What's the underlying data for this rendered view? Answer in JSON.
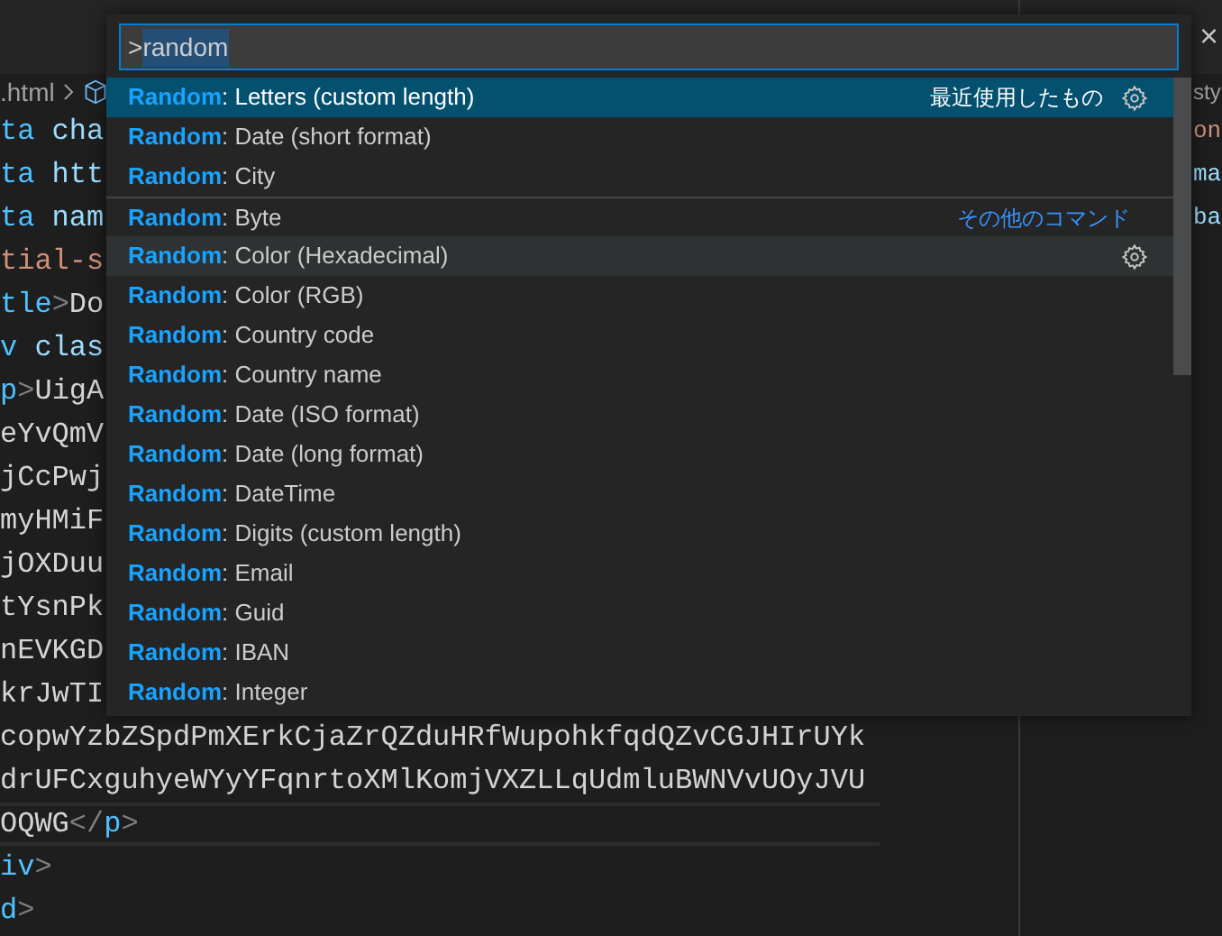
{
  "editor": {
    "breadcrumb": ".html",
    "lines": [
      {
        "segments": [
          {
            "text": "ta",
            "kind": "tag"
          },
          {
            "text": " cha",
            "kind": "attr"
          }
        ]
      },
      {
        "segments": [
          {
            "text": "ta",
            "kind": "tag"
          },
          {
            "text": " htt",
            "kind": "attr"
          }
        ]
      },
      {
        "segments": [
          {
            "text": "ta",
            "kind": "tag"
          },
          {
            "text": " nam",
            "kind": "attr"
          }
        ]
      },
      {
        "segments": [
          {
            "text": "tial-s",
            "kind": "string"
          }
        ]
      },
      {
        "segments": [
          {
            "text": "tle",
            "kind": "tag"
          },
          {
            "text": ">",
            "kind": "punct"
          },
          {
            "text": "Do",
            "kind": "text"
          }
        ]
      },
      {
        "segments": [
          {
            "text": "v",
            "kind": "tag"
          },
          {
            "text": " clas",
            "kind": "attr"
          }
        ]
      },
      {
        "segments": [
          {
            "text": "p",
            "kind": "tag"
          },
          {
            "text": ">",
            "kind": "punct"
          },
          {
            "text": "UigA",
            "kind": "text"
          }
        ]
      },
      {
        "segments": [
          {
            "text": "eYvQmV",
            "kind": "text"
          }
        ]
      },
      {
        "segments": [
          {
            "text": "jCcPwj",
            "kind": "text"
          }
        ]
      },
      {
        "segments": [
          {
            "text": "myHMiF",
            "kind": "text"
          }
        ]
      },
      {
        "segments": [
          {
            "text": "jOXDuu",
            "kind": "text"
          }
        ]
      },
      {
        "segments": [
          {
            "text": "tYsnPk",
            "kind": "text"
          }
        ]
      },
      {
        "segments": [
          {
            "text": "nEVKGD",
            "kind": "text"
          }
        ]
      },
      {
        "segments": [
          {
            "text": "krJwTI",
            "kind": "text"
          }
        ]
      },
      {
        "segments": [
          {
            "text": "copwYzbZSpdPmXErkCjaZrQZduHRfWupohkfqdQZvCGJHIrUYk",
            "kind": "text"
          }
        ]
      },
      {
        "segments": [
          {
            "text": "drUFCxguhyeWYyYFqnrtoXMlKomjVXZLLqUdmluBWNVvUOyJVU",
            "kind": "text"
          }
        ]
      },
      {
        "current": true,
        "segments": [
          {
            "text": "OQWG",
            "kind": "text"
          },
          {
            "text": "</",
            "kind": "punct"
          },
          {
            "text": "p",
            "kind": "tag"
          },
          {
            "text": ">",
            "kind": "punct"
          }
        ]
      },
      {
        "segments": [
          {
            "text": "iv",
            "kind": "tag"
          },
          {
            "text": ">",
            "kind": "punct"
          }
        ]
      },
      {
        "segments": [
          {
            "text": "d",
            "kind": "tag"
          },
          {
            "text": ">",
            "kind": "punct"
          }
        ]
      }
    ]
  },
  "side_pane": {
    "close": "×",
    "breadcrumb": "sty",
    "lines": [
      {
        "segments": [
          {
            "text": "on",
            "kind": "string"
          }
        ]
      },
      {
        "segments": [
          {
            "text": "ma",
            "kind": "attr"
          }
        ]
      },
      {
        "segments": [
          {
            "text": "ba",
            "kind": "attr"
          }
        ]
      }
    ]
  },
  "palette": {
    "input": {
      "prefix": ">",
      "value": "random"
    },
    "items": [
      {
        "label": "**Random**: Letters (custom length)",
        "selected": true,
        "hovered": false,
        "group_label": "最近使用したもの",
        "gear": true,
        "separator": false
      },
      {
        "label": "**Random**: Date (short format)",
        "selected": false,
        "hovered": false,
        "gear": false,
        "separator": false
      },
      {
        "label": "**Random**: City",
        "selected": false,
        "hovered": false,
        "gear": false,
        "separator": false
      },
      {
        "label": "**Random**: Byte",
        "selected": false,
        "hovered": false,
        "group_label": "その他のコマンド",
        "gear": false,
        "separator": true
      },
      {
        "label": "**Random**: Color (Hexadecimal)",
        "selected": false,
        "hovered": true,
        "gear": true,
        "separator": false
      },
      {
        "label": "**Random**: Color (RGB)",
        "selected": false,
        "hovered": false,
        "gear": false,
        "separator": false
      },
      {
        "label": "**Random**: Country code",
        "selected": false,
        "hovered": false,
        "gear": false,
        "separator": false
      },
      {
        "label": "**Random**: Country name",
        "selected": false,
        "hovered": false,
        "gear": false,
        "separator": false
      },
      {
        "label": "**Random**: Date (ISO format)",
        "selected": false,
        "hovered": false,
        "gear": false,
        "separator": false
      },
      {
        "label": "**Random**: Date (long format)",
        "selected": false,
        "hovered": false,
        "gear": false,
        "separator": false
      },
      {
        "label": "**Random**: DateTime",
        "selected": false,
        "hovered": false,
        "gear": false,
        "separator": false
      },
      {
        "label": "**Random**: Digits (custom length)",
        "selected": false,
        "hovered": false,
        "gear": false,
        "separator": false
      },
      {
        "label": "**Random**: Email",
        "selected": false,
        "hovered": false,
        "gear": false,
        "separator": false
      },
      {
        "label": "**Random**: Guid",
        "selected": false,
        "hovered": false,
        "gear": false,
        "separator": false
      },
      {
        "label": "**Random**: IBAN",
        "selected": false,
        "hovered": false,
        "gear": false,
        "separator": false
      },
      {
        "label": "**Random**: Integer",
        "selected": false,
        "hovered": false,
        "gear": false,
        "separator": false
      }
    ]
  }
}
